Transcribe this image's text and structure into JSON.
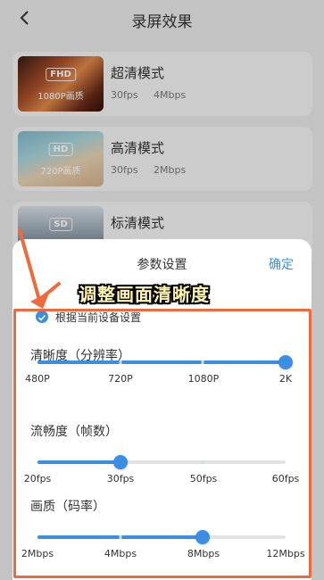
{
  "header": {
    "title": "录屏效果"
  },
  "modes": [
    {
      "name": "超清模式",
      "badge": "FHD",
      "res": "1080P画质",
      "fps": "30fps",
      "mbps": "4Mbps"
    },
    {
      "name": "高清模式",
      "badge": "HD",
      "res": "720P画质",
      "fps": "30fps",
      "mbps": "2Mbps"
    },
    {
      "name": "标清模式",
      "badge": "SD",
      "res": ""
    }
  ],
  "sheet": {
    "title": "参数设置",
    "confirm_label": "确定",
    "overlay_caption": "调整画面清晰度",
    "checkbox_label": "根据当前设备设置",
    "checkbox_checked": true
  },
  "sliders": [
    {
      "title": "清晰度（分辨率）",
      "ticks": [
        "480P",
        "720P",
        "1080P",
        "2K"
      ],
      "selected_index": 3
    },
    {
      "title": "流畅度（帧数）",
      "ticks": [
        "20fps",
        "30fps",
        "50fps",
        "60fps"
      ],
      "selected_index": 1
    },
    {
      "title": "画质（码率）",
      "ticks": [
        "2Mbps",
        "4Mbps",
        "8Mbps",
        "12Mbps"
      ],
      "selected_index": 2
    }
  ],
  "colors": {
    "accent": "#3a8ee6",
    "highlight": "#ee6a3c",
    "caption": "#fff5b0"
  }
}
